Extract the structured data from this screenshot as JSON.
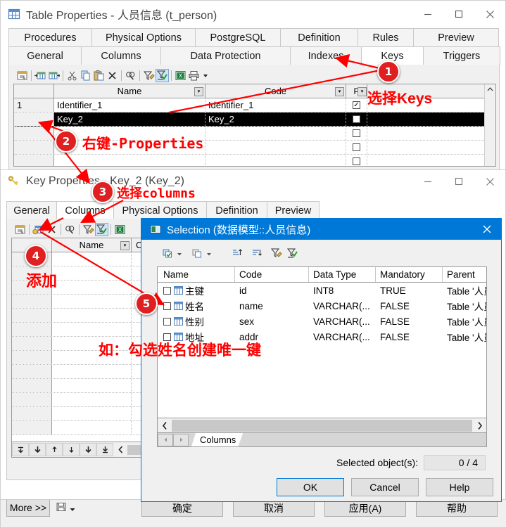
{
  "table_properties_window": {
    "title": "Table Properties - 人员信息 (t_person)",
    "icon": "table-icon",
    "minimize_label": "—",
    "maximize_label": "☐",
    "close_label": "✕",
    "tabs_row1": [
      "Procedures",
      "Physical Options",
      "PostgreSQL",
      "Definition",
      "Rules",
      "Preview"
    ],
    "tabs_row2": [
      "General",
      "Columns",
      "Data Protection",
      "Indexes",
      "Keys",
      "Triggers"
    ],
    "active_tab": "Keys",
    "toolbar_icons": [
      "properties-icon",
      "insert-row-icon",
      "add-row-icon",
      "cut-icon",
      "copy-icon",
      "paste-icon",
      "delete-icon",
      "find-icon",
      "filter-icon",
      "apply-filter-icon",
      "excel-export-icon",
      "print-icon",
      "dropdown-arrow-icon"
    ],
    "grid": {
      "headers": [
        "",
        "Name",
        "Code",
        "P..."
      ],
      "rows": [
        {
          "num": "1",
          "name": "Identifier_1",
          "code": "Identifier_1",
          "p": "checked",
          "selected": false
        },
        {
          "num": "",
          "name": "Key_2",
          "code": "Key_2",
          "p": "unchecked",
          "selected": true
        },
        {
          "num": "",
          "name": "",
          "code": "",
          "p": "unchecked",
          "selected": false
        },
        {
          "num": "",
          "name": "",
          "code": "",
          "p": "unchecked",
          "selected": false
        },
        {
          "num": "",
          "name": "",
          "code": "",
          "p": "unchecked",
          "selected": false
        }
      ]
    },
    "footer": {
      "more_label": "More >>",
      "save_icon": "save-icon",
      "dropdown_icon": "dropdown-arrow-icon",
      "buttons": [
        "确定",
        "取消",
        "应用(A)",
        "帮助"
      ]
    }
  },
  "key_properties_window": {
    "title": "Key Properties - Key_2 (Key_2)",
    "icon": "key-icon",
    "minimize_label": "—",
    "maximize_label": "☐",
    "close_label": "✕",
    "tabs": [
      "General",
      "Columns",
      "Physical Options",
      "Definition",
      "Preview"
    ],
    "active_tab": "Columns",
    "toolbar_icons": [
      "properties-icon",
      "add-columns-icon",
      "delete-icon",
      "find-icon",
      "filter-icon",
      "apply-filter-icon",
      "excel-export-icon"
    ],
    "grid": {
      "headers": [
        "",
        "Name",
        "C..."
      ],
      "row_count": 13
    },
    "nav_icons": [
      "first-icon",
      "prev-page-icon",
      "prev-icon",
      "next-icon",
      "next-page-icon",
      "last-icon"
    ],
    "scroll_left_icon": "chevron-left-icon"
  },
  "selection_dialog": {
    "title": "Selection (数据模型::人员信息)",
    "icon": "selection-icon",
    "close_label": "✕",
    "toolbar_icons": [
      "select-all-icon",
      "dropdown-arrow-icon",
      "deselect-all-icon",
      "dropdown-arrow-icon",
      "sort-asc-icon",
      "sort-desc-icon",
      "filter-icon",
      "apply-filter-icon"
    ],
    "table": {
      "headers": [
        "Name",
        "Code",
        "Data Type",
        "Mandatory",
        "Parent"
      ],
      "rows": [
        {
          "checked": false,
          "icon": "column-icon",
          "name": "主键",
          "code": "id",
          "data_type": "INT8",
          "mandatory": "TRUE",
          "parent": "Table '人员"
        },
        {
          "checked": false,
          "icon": "column-icon",
          "name": "姓名",
          "code": "name",
          "data_type": "VARCHAR(...",
          "mandatory": "FALSE",
          "parent": "Table '人员"
        },
        {
          "checked": false,
          "icon": "column-icon",
          "name": "性别",
          "code": "sex",
          "data_type": "VARCHAR(...",
          "mandatory": "FALSE",
          "parent": "Table '人员"
        },
        {
          "checked": false,
          "icon": "column-icon",
          "name": "地址",
          "code": "addr",
          "data_type": "VARCHAR(...",
          "mandatory": "FALSE",
          "parent": "Table '人员"
        }
      ]
    },
    "hscroll": {
      "left_icon": "chevron-left-icon",
      "right_icon": "chevron-right-icon"
    },
    "sheet_tabs": {
      "prev_icon": "triangle-left-icon",
      "next_icon": "triangle-right-icon",
      "tabs": [
        "Columns"
      ]
    },
    "status": {
      "label": "Selected object(s):",
      "value": "0 / 4"
    },
    "buttons": {
      "ok": "OK",
      "cancel": "Cancel",
      "help": "Help"
    }
  },
  "annotations": {
    "badges": [
      {
        "n": "1"
      },
      {
        "n": "2"
      },
      {
        "n": "3"
      },
      {
        "n": "4"
      },
      {
        "n": "5"
      }
    ],
    "texts": {
      "select_keys": "选择Keys",
      "right_click_properties": "右键-Properties",
      "select_columns": "选择columns",
      "add": "添加",
      "example_check_name": "如：勾选姓名创建唯一键"
    },
    "accent_color": "#ff0000"
  }
}
